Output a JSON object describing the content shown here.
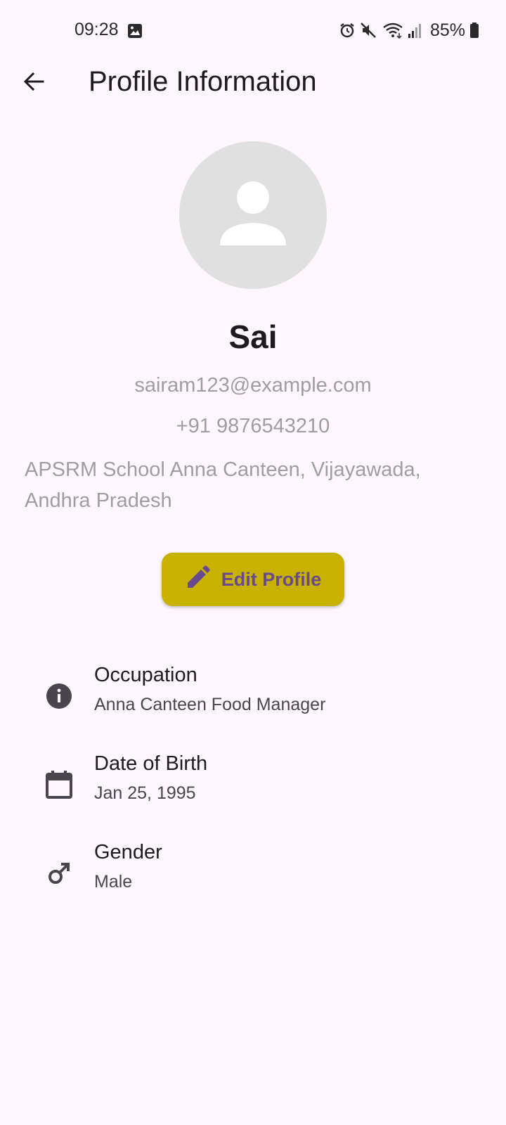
{
  "status_bar": {
    "time": "09:28",
    "battery": "85%",
    "icons": [
      "gallery-icon",
      "alarm-icon",
      "mute-icon",
      "wifi-icon",
      "signal-icon",
      "battery-icon"
    ]
  },
  "app_bar": {
    "title": "Profile Information",
    "back_icon": "arrow-back-icon"
  },
  "profile": {
    "name": "Sai",
    "email": "sairam123@example.com",
    "phone": "+91 9876543210",
    "address": "APSRM School Anna Canteen, Vijayawada, Andhra Pradesh",
    "avatar_icon": "person-icon"
  },
  "edit_button": {
    "label": "Edit Profile",
    "icon": "pencil-icon"
  },
  "details": [
    {
      "title": "Occupation",
      "value": "Anna Canteen Food Manager",
      "icon": "info-icon"
    },
    {
      "title": "Date of Birth",
      "value": "Jan 25, 1995",
      "icon": "calendar-icon"
    },
    {
      "title": "Gender",
      "value": "Male",
      "icon": "male-icon"
    }
  ],
  "colors": {
    "background": "#fdf7fd",
    "button": "#c9b100",
    "button_text": "#6a4a8e",
    "secondary_text": "#9e9e9e",
    "avatar_bg": "#e0e0e0"
  }
}
